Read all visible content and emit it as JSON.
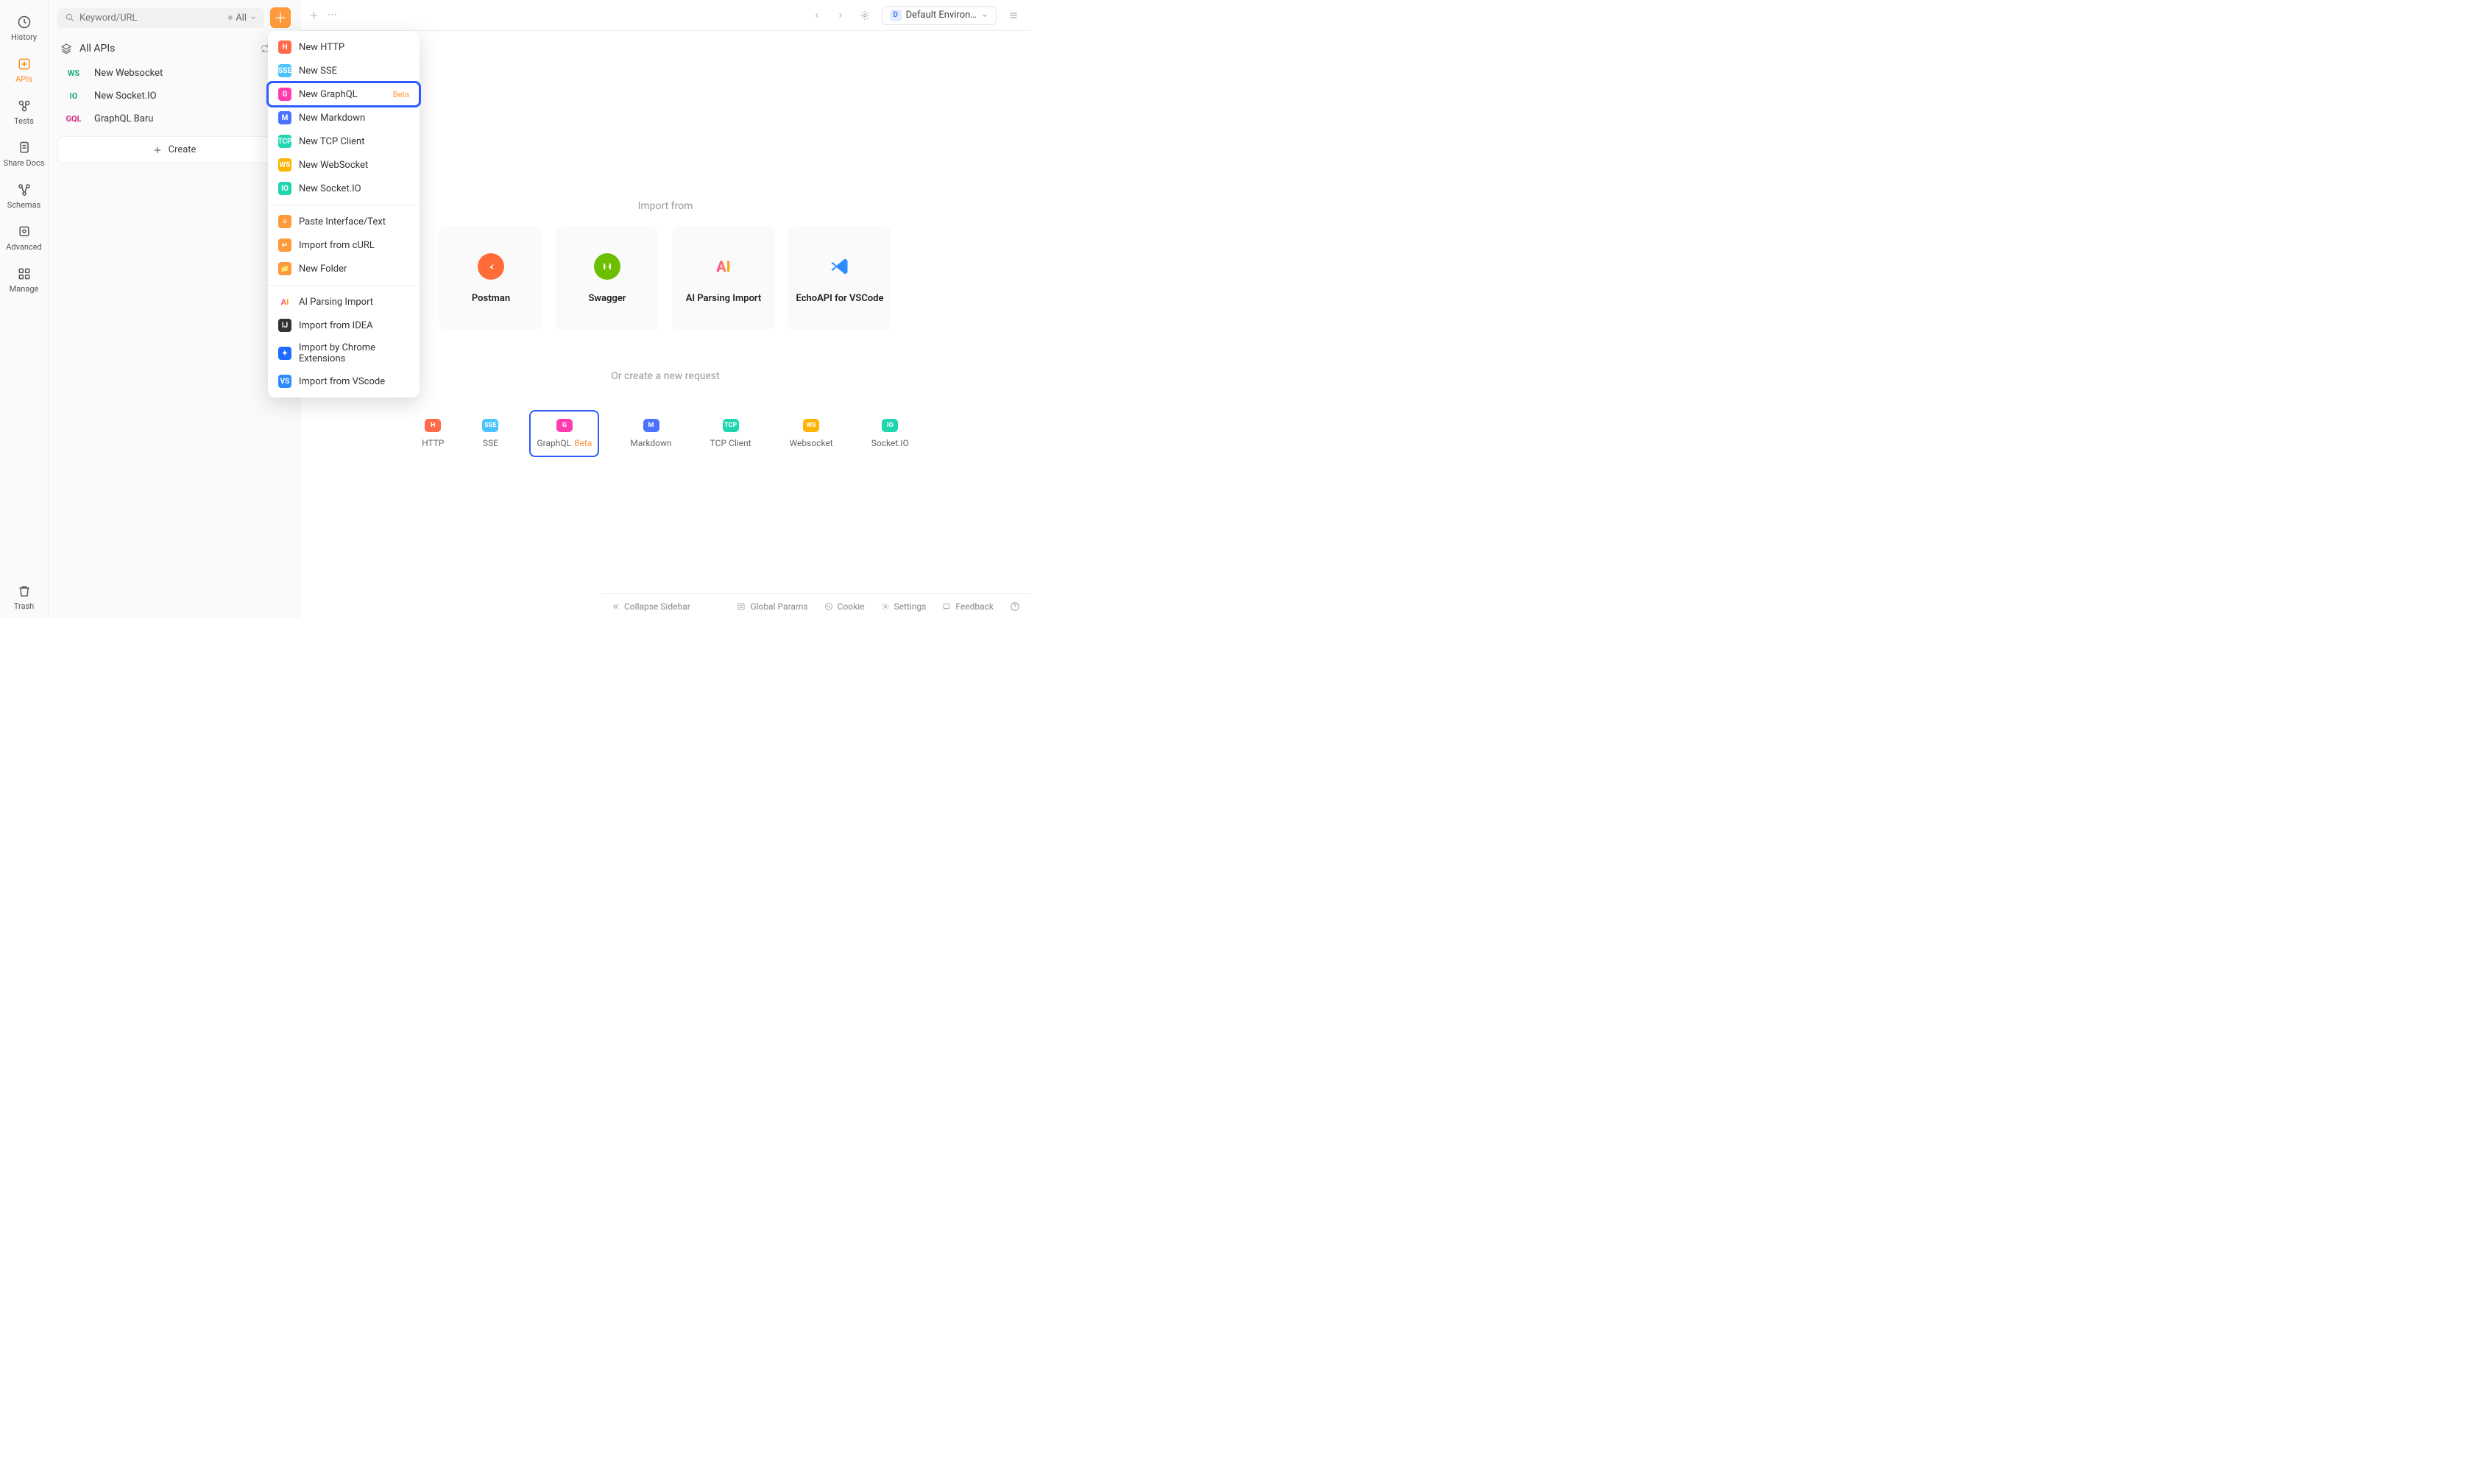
{
  "rail": {
    "items": [
      {
        "label": "History"
      },
      {
        "label": "APIs"
      },
      {
        "label": "Tests"
      },
      {
        "label": "Share Docs"
      },
      {
        "label": "Schemas"
      },
      {
        "label": "Advanced"
      },
      {
        "label": "Manage"
      }
    ],
    "trash": "Trash"
  },
  "sidebar": {
    "search_placeholder": "Keyword/URL",
    "filter_label": "All",
    "header": "All APIs",
    "items": [
      {
        "tag": "WS",
        "label": "New Websocket"
      },
      {
        "tag": "IO",
        "label": "New Socket.IO"
      },
      {
        "tag": "GQL",
        "label": "GraphQL Baru"
      }
    ],
    "create": "Create"
  },
  "menu": {
    "groups": [
      [
        {
          "icon": "#ff6b4a",
          "txt": "H",
          "label": "New HTTP"
        },
        {
          "icon": "#4ac3ff",
          "txt": "SSE",
          "label": "New SSE"
        },
        {
          "icon": "#ff3cae",
          "txt": "G",
          "label": "New GraphQL",
          "beta": "Beta",
          "highlight": true
        },
        {
          "icon": "#4a72ff",
          "txt": "M",
          "label": "New Markdown"
        },
        {
          "icon": "#1fd6b0",
          "txt": "TCP",
          "label": "New TCP Client"
        },
        {
          "icon": "#ffb300",
          "txt": "WS",
          "label": "New WebSocket"
        },
        {
          "icon": "#1fd6b0",
          "txt": "IO",
          "label": "New Socket.IO"
        }
      ],
      [
        {
          "icon": "#ff9a3c",
          "txt": "≡",
          "label": "Paste Interface/Text"
        },
        {
          "icon": "#ff9a3c",
          "txt": "↵",
          "label": "Import from cURL"
        },
        {
          "icon": "#ff9a3c",
          "txt": "📁",
          "label": "New Folder"
        }
      ],
      [
        {
          "icon": "transparent",
          "txt": "AI",
          "label": "AI Parsing Import",
          "ai": true
        },
        {
          "icon": "#333",
          "txt": "IJ",
          "label": "Import from IDEA"
        },
        {
          "icon": "#1f6bff",
          "txt": "✦",
          "label": "Import by Chrome Extensions"
        },
        {
          "icon": "#2c8cff",
          "txt": "VS",
          "label": "Import from VScode"
        }
      ]
    ]
  },
  "tabbar": {
    "env": "Default Environ…"
  },
  "main": {
    "import_title": "Import from",
    "cards": [
      {
        "label": "Postman",
        "color": "#ff6c37"
      },
      {
        "label": "Swagger",
        "color": "#6cbf00"
      },
      {
        "label": "AI Parsing Import",
        "ai": true
      },
      {
        "label": "EchoAPI for VSCode",
        "color": "#2c8cff"
      }
    ],
    "create_title": "Or create a new request",
    "requests": [
      {
        "label": "HTTP",
        "bg": "#ff6b4a",
        "txt": "H"
      },
      {
        "label": "SSE",
        "bg": "#4ac3ff",
        "txt": "SSE"
      },
      {
        "label": "GraphQL",
        "bg": "#ff3cae",
        "txt": "G",
        "beta": "Beta",
        "sel": true
      },
      {
        "label": "Markdown",
        "bg": "#4a72ff",
        "txt": "M"
      },
      {
        "label": "TCP Client",
        "bg": "#1fd6b0",
        "txt": "TCP"
      },
      {
        "label": "Websocket",
        "bg": "#ffb300",
        "txt": "WS"
      },
      {
        "label": "Socket.IO",
        "bg": "#1fd6b0",
        "txt": "IO"
      }
    ]
  },
  "footer": {
    "collapse": "Collapse Sidebar",
    "links": [
      "Global Params",
      "Cookie",
      "Settings",
      "Feedback"
    ]
  }
}
